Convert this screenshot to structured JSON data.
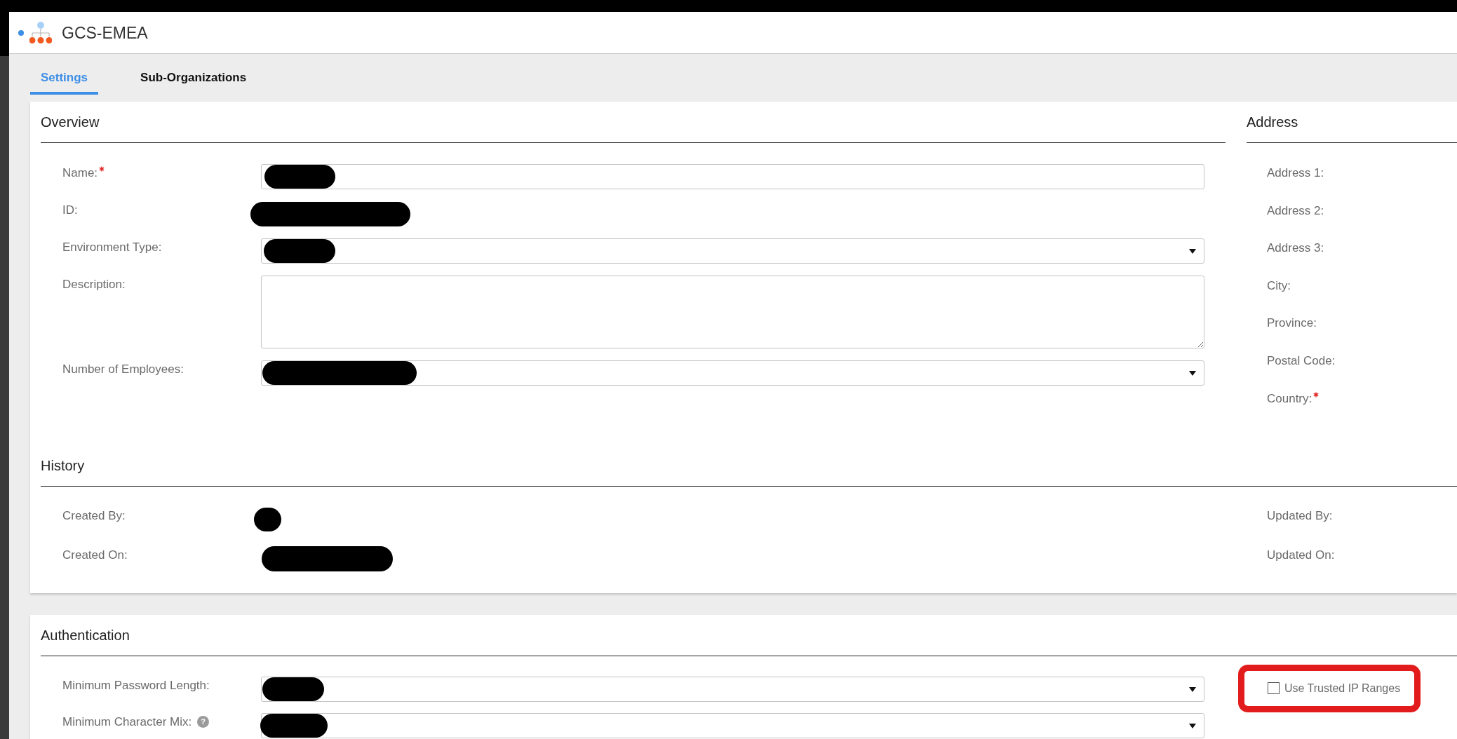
{
  "header": {
    "title": "GCS-EMEA"
  },
  "tabs": [
    {
      "label": "Settings",
      "selected": true
    },
    {
      "label": "Sub-Organizations",
      "selected": false
    }
  ],
  "overview": {
    "title": "Overview",
    "fields": [
      {
        "label": "Name:",
        "kind": "text",
        "required": true,
        "redacted": true
      },
      {
        "label": "ID:",
        "kind": "static",
        "required": false,
        "redacted": true
      },
      {
        "label": "Environment Type:",
        "kind": "select",
        "required": false,
        "redacted": true
      },
      {
        "label": "Description:",
        "kind": "textarea",
        "required": false,
        "redacted": false
      },
      {
        "label": "Number of Employees:",
        "kind": "select",
        "required": false,
        "redacted": true
      }
    ]
  },
  "address": {
    "title": "Address",
    "fields": [
      {
        "label": "Address 1:",
        "required": false
      },
      {
        "label": "Address 2:",
        "required": false
      },
      {
        "label": "Address 3:",
        "required": false
      },
      {
        "label": "City:",
        "required": false
      },
      {
        "label": "Province:",
        "required": false
      },
      {
        "label": "Postal Code:",
        "required": false
      },
      {
        "label": "Country:",
        "required": true
      }
    ]
  },
  "history": {
    "title": "History",
    "fields": [
      {
        "label": "Created By:",
        "redacted": true
      },
      {
        "label": "Created On:",
        "redacted": true
      }
    ],
    "right_fields": [
      {
        "label": "Updated By:"
      },
      {
        "label": "Updated On:"
      }
    ]
  },
  "authentication": {
    "title": "Authentication",
    "fields": [
      {
        "label": "Minimum Password Length:",
        "kind": "select",
        "redacted": true
      },
      {
        "label": "Minimum Character Mix:",
        "kind": "select",
        "help_icon": "?",
        "redacted": true
      }
    ],
    "options": [
      {
        "label": "Use Trusted IP Ranges",
        "checked": false,
        "highlighted": true
      }
    ]
  }
}
